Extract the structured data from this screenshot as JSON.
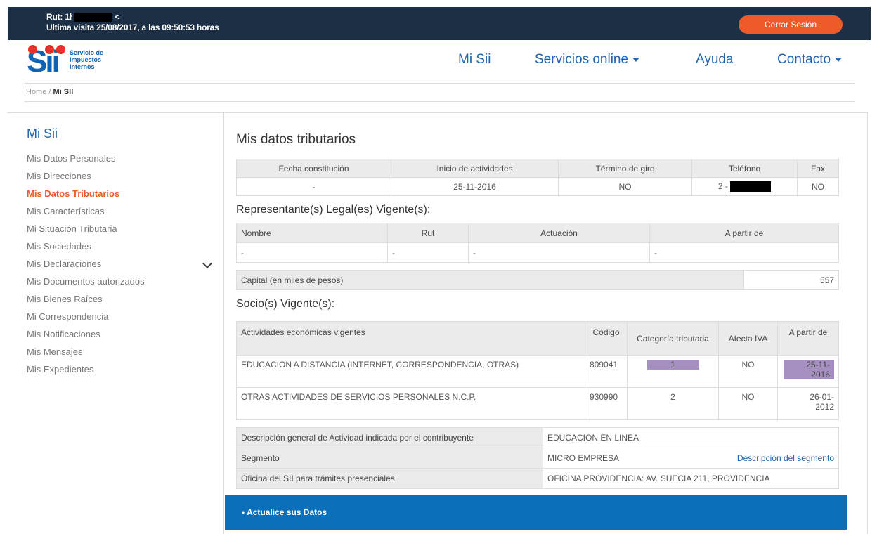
{
  "session": {
    "rut_prefix": "Rut: 1ł",
    "rut_suffix": "<",
    "last_visit": "Ultima visita 25/08/2017, a las 09:50:53 horas",
    "logout_label": "Cerrar Sesión"
  },
  "logo": {
    "mark": "Sii",
    "line1": "Servicio de",
    "line2": "Impuestos",
    "line3": "Internos"
  },
  "nav": {
    "mi_sii": "Mi Sii",
    "servicios": "Servicios online",
    "ayuda": "Ayuda",
    "contacto": "Contacto"
  },
  "breadcrumb": {
    "home": "Home",
    "sep": "/",
    "current": "Mi SII"
  },
  "sidebar": {
    "title": "Mi Sii",
    "items": [
      {
        "label": "Mis Datos Personales"
      },
      {
        "label": "Mis Direcciones"
      },
      {
        "label": "Mis Datos Tributarios"
      },
      {
        "label": "Mis Características"
      },
      {
        "label": "Mi Situación Tributaria"
      },
      {
        "label": "Mis Sociedades"
      },
      {
        "label": "Mis Declaraciones"
      },
      {
        "label": "Mis Documentos autorizados"
      },
      {
        "label": "Mis Bienes Raíces"
      },
      {
        "label": "Mi Correspondencia"
      },
      {
        "label": "Mis Notificaciones"
      },
      {
        "label": "Mis Mensajes"
      },
      {
        "label": "Mis Expedientes"
      }
    ],
    "active_index": 2
  },
  "main": {
    "title": "Mis datos tributarios",
    "general": {
      "headers": [
        "Fecha constitución",
        "Inicio de actividades",
        "Término de giro",
        "Teléfono",
        "Fax"
      ],
      "row": [
        "-",
        "25-11-2016",
        "NO",
        "2 -",
        "NO"
      ]
    },
    "legal_title": "Representante(s) Legal(es) Vigente(s):",
    "legal": {
      "headers": [
        "Nombre",
        "Rut",
        "Actuación",
        "A partir de"
      ],
      "row": [
        "-",
        "-",
        "-",
        "-"
      ]
    },
    "capital": {
      "label": "Capital (en miles de pesos)",
      "value": "557"
    },
    "socios_title": "Socio(s) Vigente(s):",
    "actividades": {
      "headers": [
        "Actividades económicas vigentes",
        "Código",
        "Categoría tributaria",
        "Afecta IVA",
        "A partir de"
      ],
      "rows": [
        [
          "EDUCACION A DISTANCIA (INTERNET, CORRESPONDENCIA, OTRAS)",
          "809041",
          "1",
          "NO",
          "25-11-2016"
        ],
        [
          "OTRAS ACTIVIDADES DE SERVICIOS PERSONALES N.C.P.",
          "930990",
          "2",
          "NO",
          "26-01-2012"
        ]
      ]
    },
    "info": {
      "desc_label": "Descripción general de Actividad indicada por el contribuyente",
      "desc_value": "EDUCACION EN LINEA",
      "segmento_label": "Segmento",
      "segmento_value": "MICRO EMPRESA",
      "segmento_link": "Descripción del segmento",
      "oficina_label": "Oficina del SII para trámites presenciales",
      "oficina_value": "OFICINA PROVIDENCIA: AV. SUECIA 211, PROVIDENCIA"
    },
    "banner": "• Actualice sus Datos"
  },
  "colors": {
    "topbar": "#1c2f44",
    "logout": "#f05a28",
    "link": "#2263ad",
    "active": "#f05a28",
    "banner": "#0c6fb9",
    "highlight": "#a58fc0"
  }
}
